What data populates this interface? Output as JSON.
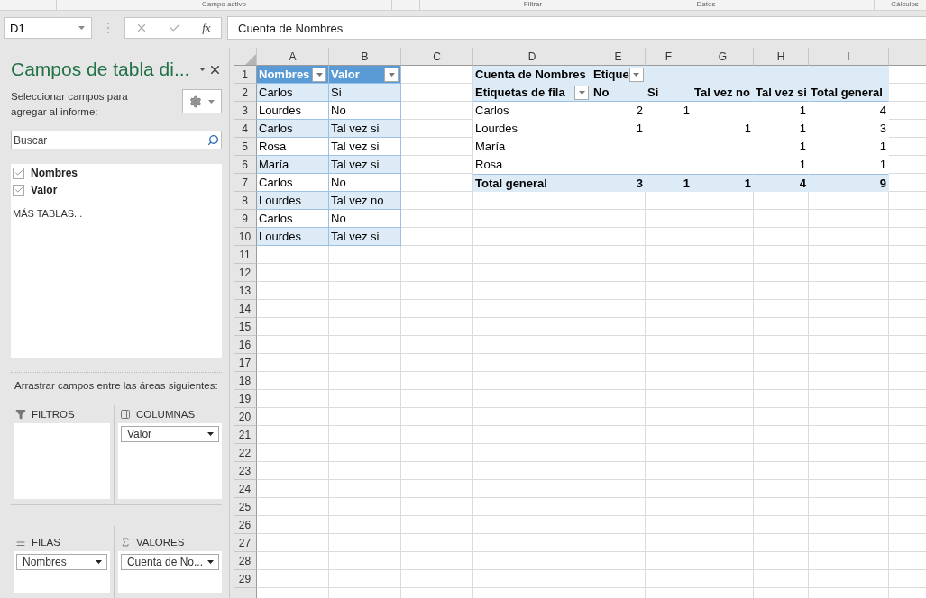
{
  "ribbon_groups": [
    "Campo activo",
    "Filtrar",
    "Datos",
    "Cálculos"
  ],
  "formula_bar": {
    "name_box": "D1",
    "function_label": "fx",
    "formula": "Cuenta de Nombres"
  },
  "field_pane": {
    "title": "Campos de tabla di...",
    "subtitle": "Seleccionar campos para agregar al informe:",
    "search": {
      "placeholder": "Buscar"
    },
    "fields": [
      {
        "label": "Nombres",
        "checked": true
      },
      {
        "label": "Valor",
        "checked": true
      }
    ],
    "more_tables": "MÁS TABLAS...",
    "drag_hint": "Arrastrar campos entre las áreas siguientes:",
    "areas": [
      {
        "kind": "filters",
        "label": "FILTROS"
      },
      {
        "kind": "columns",
        "label": "COLUMNAS",
        "fields": [
          "Valor"
        ]
      },
      {
        "kind": "rows",
        "label": "FILAS",
        "fields": [
          "Nombres"
        ]
      },
      {
        "kind": "values",
        "label": "VALORES",
        "fields": [
          "Cuenta de No..."
        ]
      }
    ]
  },
  "sheet": {
    "columns": [
      "A",
      "B",
      "C",
      "D",
      "E",
      "F",
      "G",
      "H",
      "I"
    ],
    "rows": [
      {
        "number": "1",
        "cells": [
          {
            "text": "Nombres",
            "kind": "th",
            "filter": true
          },
          {
            "text": "Valor",
            "kind": "th",
            "filter": true
          },
          {},
          {
            "text": "Cuenta de Nombres",
            "kind": "ph"
          },
          {
            "text": "Etique",
            "kind": "ph",
            "filter": true
          },
          {
            "kind": "ph"
          },
          {
            "kind": "ph"
          },
          {
            "kind": "ph"
          },
          {
            "kind": "ph"
          }
        ]
      },
      {
        "number": "2",
        "cells": [
          {
            "text": "Carlos",
            "kind": "band"
          },
          {
            "text": "Si",
            "kind": "band"
          },
          {},
          {
            "text": "Etiquetas de fila",
            "kind": "ph2",
            "filter": true
          },
          {
            "text": "No",
            "kind": "ph2"
          },
          {
            "text": "Si",
            "kind": "ph2"
          },
          {
            "text": "Tal vez no",
            "kind": "ph2"
          },
          {
            "text": "Tal vez si",
            "kind": "ph2"
          },
          {
            "text": "Total general",
            "kind": "ph2"
          }
        ]
      },
      {
        "number": "3",
        "cells": [
          {
            "text": "Lourdes",
            "kind": "tb"
          },
          {
            "text": "No",
            "kind": "tb"
          },
          {},
          {
            "text": "Carlos",
            "kind": "pl"
          },
          {
            "text": "2",
            "kind": "pn"
          },
          {
            "text": "1",
            "kind": "pn"
          },
          {
            "kind": "pn"
          },
          {
            "text": "1",
            "kind": "pn"
          },
          {
            "text": "4",
            "kind": "pn"
          }
        ]
      },
      {
        "number": "4",
        "cells": [
          {
            "text": "Carlos",
            "kind": "band"
          },
          {
            "text": "Tal vez si",
            "kind": "band"
          },
          {},
          {
            "text": "Lourdes",
            "kind": "pl"
          },
          {
            "text": "1",
            "kind": "pn"
          },
          {
            "kind": "pn"
          },
          {
            "text": "1",
            "kind": "pn"
          },
          {
            "text": "1",
            "kind": "pn"
          },
          {
            "text": "3",
            "kind": "pn"
          }
        ]
      },
      {
        "number": "5",
        "cells": [
          {
            "text": "Rosa",
            "kind": "tb"
          },
          {
            "text": "Tal vez si",
            "kind": "tb"
          },
          {},
          {
            "text": "María",
            "kind": "pl"
          },
          {
            "kind": "pn"
          },
          {
            "kind": "pn"
          },
          {
            "kind": "pn"
          },
          {
            "text": "1",
            "kind": "pn"
          },
          {
            "text": "1",
            "kind": "pn"
          }
        ]
      },
      {
        "number": "6",
        "cells": [
          {
            "text": "María",
            "kind": "band"
          },
          {
            "text": "Tal vez si",
            "kind": "band"
          },
          {},
          {
            "text": "Rosa",
            "kind": "pl"
          },
          {
            "kind": "pn"
          },
          {
            "kind": "pn"
          },
          {
            "kind": "pn"
          },
          {
            "text": "1",
            "kind": "pn"
          },
          {
            "text": "1",
            "kind": "pn"
          }
        ]
      },
      {
        "number": "7",
        "cells": [
          {
            "text": "Carlos",
            "kind": "tb"
          },
          {
            "text": "No",
            "kind": "tb"
          },
          {},
          {
            "text": "Total general",
            "kind": "ptl"
          },
          {
            "text": "3",
            "kind": "ptn"
          },
          {
            "text": "1",
            "kind": "ptn"
          },
          {
            "text": "1",
            "kind": "ptn"
          },
          {
            "text": "4",
            "kind": "ptn"
          },
          {
            "text": "9",
            "kind": "ptn"
          }
        ]
      },
      {
        "number": "8",
        "cells": [
          {
            "text": "Lourdes",
            "kind": "band"
          },
          {
            "text": "Tal vez no",
            "kind": "band"
          }
        ]
      },
      {
        "number": "9",
        "cells": [
          {
            "text": "Carlos",
            "kind": "tb"
          },
          {
            "text": "No",
            "kind": "tb"
          }
        ]
      },
      {
        "number": "10",
        "cells": [
          {
            "text": "Lourdes",
            "kind": "band"
          },
          {
            "text": "Tal vez si",
            "kind": "band"
          }
        ]
      },
      {
        "number": "11"
      },
      {
        "number": "12"
      },
      {
        "number": "13"
      },
      {
        "number": "14"
      },
      {
        "number": "15"
      },
      {
        "number": "16"
      },
      {
        "number": "17"
      },
      {
        "number": "18"
      },
      {
        "number": "19"
      },
      {
        "number": "20"
      },
      {
        "number": "21"
      },
      {
        "number": "22"
      },
      {
        "number": "23"
      },
      {
        "number": "24"
      },
      {
        "number": "25"
      },
      {
        "number": "26"
      },
      {
        "number": "27"
      },
      {
        "number": "28"
      },
      {
        "number": "29"
      }
    ]
  }
}
